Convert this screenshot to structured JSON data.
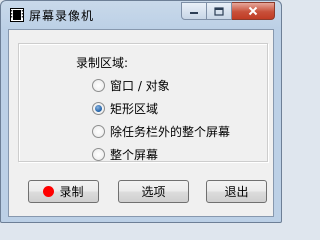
{
  "window": {
    "title": "屏幕录像机"
  },
  "capture_area": {
    "label": "录制区域:",
    "options": [
      {
        "label": "窗口 / 对象",
        "checked": false
      },
      {
        "label": "矩形区域",
        "checked": true
      },
      {
        "label": "除任务栏外的整个屏幕",
        "checked": false
      },
      {
        "label": "整个屏幕",
        "checked": false
      }
    ]
  },
  "buttons": {
    "record": "录制",
    "options": "选项",
    "exit": "退出"
  },
  "colors": {
    "record_dot": "#ff0000",
    "close_button": "#c8503a"
  }
}
